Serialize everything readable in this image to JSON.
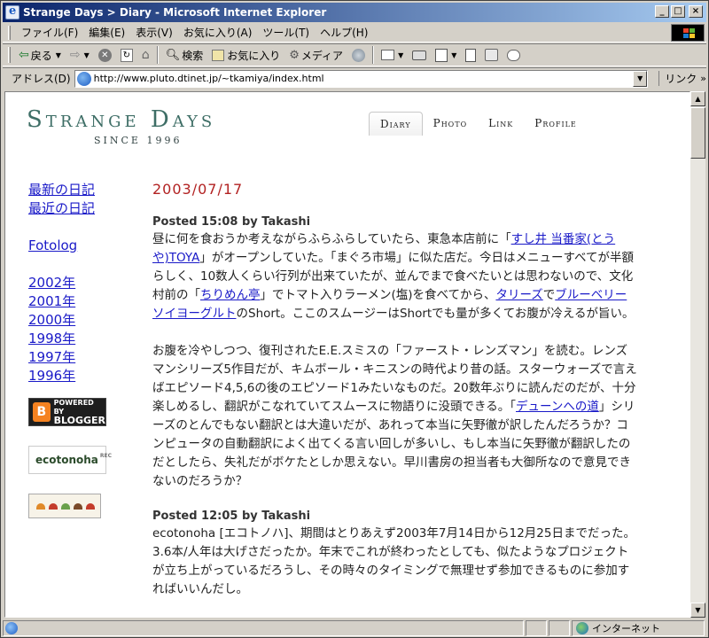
{
  "window": {
    "title": "Strange Days > Diary - Microsoft Internet Explorer",
    "buttons": [
      "_",
      "□",
      "×"
    ]
  },
  "menu": [
    "ファイル(F)",
    "編集(E)",
    "表示(V)",
    "お気に入り(A)",
    "ツール(T)",
    "ヘルプ(H)"
  ],
  "toolbar": {
    "back": "戻る",
    "search": "検索",
    "favorites": "お気に入り",
    "media": "メディア"
  },
  "address": {
    "label": "アドレス(D)",
    "url": "http://www.pluto.dtinet.jp/~tkamiya/index.html",
    "links": "リンク"
  },
  "status": {
    "zone": "インターネット"
  },
  "site": {
    "logo": "Strange Days",
    "since": "SINCE 1996",
    "nav": [
      "Diary",
      "Photo",
      "Link",
      "Profile"
    ]
  },
  "sidebar": {
    "links1": [
      "最新の日記",
      "最近の日記"
    ],
    "fotolog": "Fotolog",
    "years": [
      "2002年",
      "2001年",
      "2000年",
      "1998年",
      "1997年",
      "1996年"
    ],
    "blogger_line1": "POWERED BY",
    "blogger_line2": "BLOGGER",
    "ecotonoha": "ecotonoha",
    "ecotonoha_rec": "REC"
  },
  "main": {
    "date": "2003/07/17",
    "entry1": {
      "posted": "Posted 15:08 by Takashi",
      "p1_a": "昼に何を食おうか考えながらふらふらしていたら、東急本店前に「",
      "p1_link1": "すし井 当番家(とうや)TOYA",
      "p1_b": "」がオープンしていた。「まぐろ市場」に似た店だ。今日はメニューすべてが半額らしく、10数人くらい行列が出来ていたが、並んでまで食べたいとは思わないので、文化村前の「",
      "p1_link2": "ちりめん亭",
      "p1_c": "」でトマト入りラーメン(塩)を食べてから、",
      "p1_link3": "タリーズ",
      "p1_d": "で",
      "p1_link4": "ブルーベリーソイヨーグルト",
      "p1_e": "のShort。ここのスムージーはShortでも量が多くてお腹が冷えるが旨い。",
      "p2_a": "お腹を冷やしつつ、復刊されたE.E.スミスの「ファースト・レンズマン」を読む。レンズマンシリーズ5作目だが、キムボール・キニスンの時代より昔の話。スターウォーズで言えばエピソード4,5,6の後のエピソード1みたいなものだ。20数年ぶりに読んだのだが、十分楽しめるし、翻訳がこなれていてスムースに物語りに没頭できる。「",
      "p2_link": "デューンへの道",
      "p2_b": "」シリーズのとんでもない翻訳とは大違いだが、あれって本当に矢野徹が訳したんだろうか？コンピュータの自動翻訳によく出てくる言い回しが多いし、もし本当に矢野徹が翻訳したのだとしたら、失礼だがボケたとしか思えない。早川書房の担当者も大御所なので意見できないのだろうか？"
    },
    "entry2": {
      "posted": "Posted 12:05 by Takashi",
      "p1": "ecotonoha [エコトノハ]、期間はとりあえず2003年7月14日から12月25日までだった。3.6本/人年は大げさだったか。年末でこれが終わったとしても、似たようなプロジェクトが立ち上がっているだろうし、その時々のタイミングで無理せず参加できるものに参加すればいいんだし。"
    }
  }
}
